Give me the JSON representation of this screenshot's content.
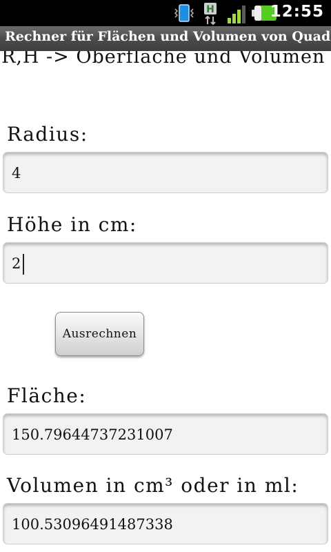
{
  "status_bar": {
    "time": "12:55",
    "icons": [
      "vibrate-icon",
      "data-transfer-h-icon",
      "signal-icon",
      "battery-icon"
    ],
    "network_label": "H"
  },
  "title_bar": {
    "title": "Rechner für Flächen und Volumen von Quadern"
  },
  "form": {
    "heading": "R,H -> Oberfläche und Volumen",
    "radius_label": "Radius:",
    "radius_value": "4",
    "height_label": "Höhe in cm:",
    "height_value": "2",
    "calculate_label": "Ausrechnen",
    "area_label": "Fläche:",
    "area_value": "150.79644737231007",
    "volume_label": "Volumen in cm³ oder in ml:",
    "volume_value": "100.53096491487338"
  },
  "colors": {
    "status_bar_bg": "#000000",
    "title_bar_bg": "#4a4a4a",
    "battery": "#55cc22",
    "signal": "#9fd94a"
  }
}
